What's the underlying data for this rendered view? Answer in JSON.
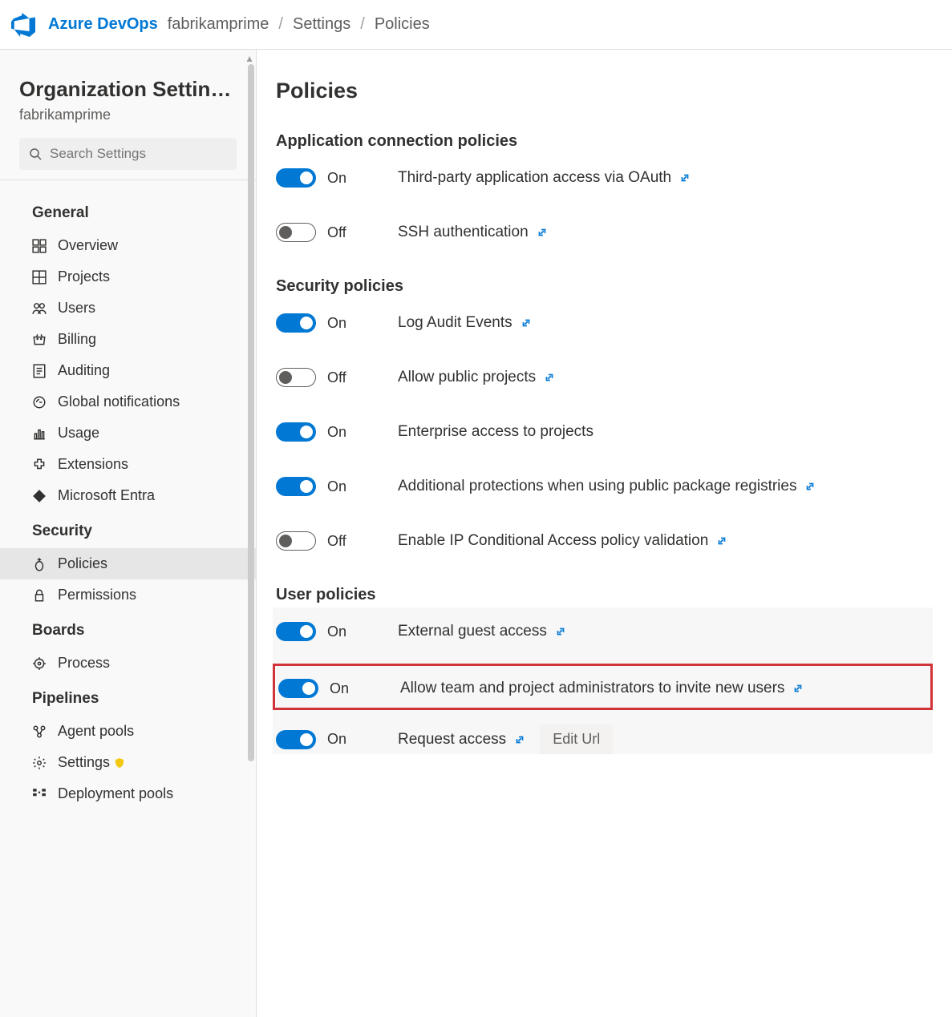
{
  "header": {
    "brand": "Azure DevOps",
    "breadcrumb": [
      "fabrikamprime",
      "Settings",
      "Policies"
    ]
  },
  "sidebar": {
    "title": "Organization Settin…",
    "subtitle": "fabrikamprime",
    "search_placeholder": "Search Settings",
    "sections": {
      "general": {
        "label": "General",
        "items": {
          "overview": "Overview",
          "projects": "Projects",
          "users": "Users",
          "billing": "Billing",
          "auditing": "Auditing",
          "global_notifications": "Global notifications",
          "usage": "Usage",
          "extensions": "Extensions",
          "entra": "Microsoft Entra"
        }
      },
      "security": {
        "label": "Security",
        "items": {
          "policies": "Policies",
          "permissions": "Permissions"
        }
      },
      "boards": {
        "label": "Boards",
        "items": {
          "process": "Process"
        }
      },
      "pipelines": {
        "label": "Pipelines",
        "items": {
          "agent_pools": "Agent pools",
          "settings": "Settings",
          "deployment_pools": "Deployment pools"
        }
      }
    }
  },
  "main": {
    "title": "Policies",
    "toggle_on": "On",
    "toggle_off": "Off",
    "sections": {
      "app_conn": {
        "title": "Application connection policies",
        "items": {
          "oauth": {
            "label": "Third-party application access via OAuth",
            "state": "on",
            "link": true
          },
          "ssh": {
            "label": "SSH authentication",
            "state": "off",
            "link": true
          }
        }
      },
      "security": {
        "title": "Security policies",
        "items": {
          "log_audit": {
            "label": "Log Audit Events",
            "state": "on",
            "link": true
          },
          "public_projects": {
            "label": "Allow public projects",
            "state": "off",
            "link": true
          },
          "enterprise_access": {
            "label": "Enterprise access to projects",
            "state": "on",
            "link": false
          },
          "public_pkg": {
            "label": "Additional protections when using public package registries",
            "state": "on",
            "link": true
          },
          "ip_cond": {
            "label": "Enable IP Conditional Access policy validation",
            "state": "off",
            "link": true
          }
        }
      },
      "user": {
        "title": "User policies",
        "items": {
          "guest": {
            "label": "External guest access",
            "state": "on",
            "link": true
          },
          "invite": {
            "label": "Allow team and project administrators to invite new users",
            "state": "on",
            "link": true
          },
          "request": {
            "label": "Request access",
            "state": "on",
            "link": true,
            "button": "Edit Url"
          }
        }
      }
    }
  }
}
